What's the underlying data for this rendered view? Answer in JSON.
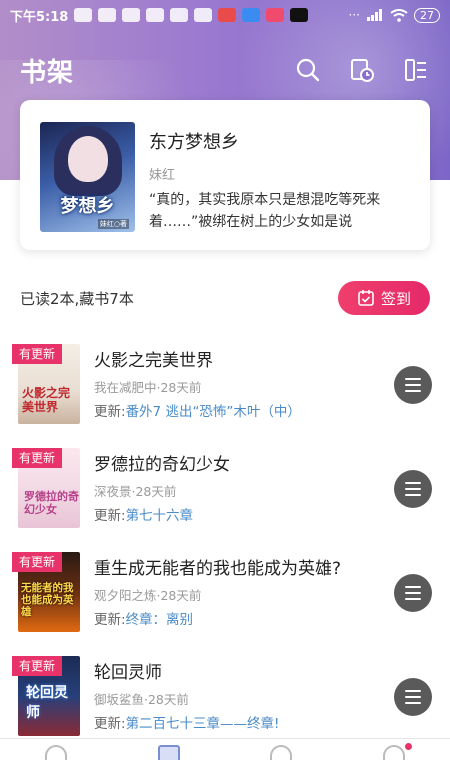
{
  "status_bar": {
    "time": "下午5:18",
    "battery": "27"
  },
  "header": {
    "title": "书架"
  },
  "featured": {
    "title": "东方梦想乡",
    "author": "妹红",
    "description": "“真的，其实我原本只是想混吃等死来着……”被绑在树上的少女如是说",
    "cover_text": "梦想乡",
    "cover_author": "妹红○著"
  },
  "stats": {
    "text": "已读2本,藏书7本",
    "checkin_label": "签到"
  },
  "books": [
    {
      "badge": "有更新",
      "title": "火影之完美世界",
      "author_time": "我在减肥中·28天前",
      "update_label": "更新:",
      "update_value": "番外7 逃出“恐怖”木叶（中）",
      "cover_text": "火影之完美世界"
    },
    {
      "badge": "有更新",
      "title": "罗德拉的奇幻少女",
      "author_time": "深夜景·28天前",
      "update_label": "更新:",
      "update_value": "第七十六章",
      "cover_text": "罗德拉的奇幻少女"
    },
    {
      "badge": "有更新",
      "title": "重生成无能者的我也能成为英雄?",
      "author_time": "观夕阳之炼·28天前",
      "update_label": "更新:",
      "update_value": "终章：离别",
      "cover_text": "无能者的我也能成为英雄"
    },
    {
      "badge": "有更新",
      "title": "轮回灵师",
      "author_time": "御坂鲨鱼·28天前",
      "update_label": "更新:",
      "update_value": "第二百七十三章——终章!",
      "cover_text": "轮回灵师"
    }
  ],
  "colors": {
    "accent": "#e8336a",
    "link": "#4a8bc8",
    "header_bg": "#9b7ad0"
  },
  "icons": {
    "search": "search-icon",
    "history": "history-icon",
    "manage": "list-manage-icon",
    "checkin": "calendar-check-icon",
    "book_menu": "menu-icon"
  }
}
